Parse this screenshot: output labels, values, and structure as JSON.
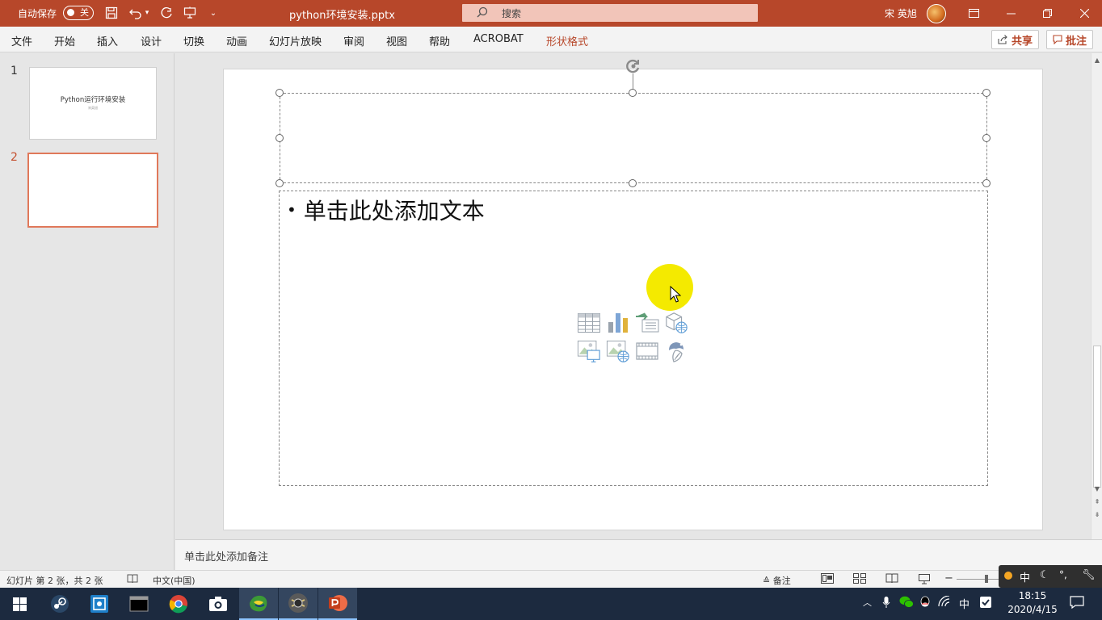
{
  "titlebar": {
    "autosave_label": "自动保存",
    "autosave_state": "关",
    "document_title": "python环境安装.pptx",
    "search_placeholder": "搜索",
    "user_name": "宋 英旭",
    "accent_color": "#b7472a"
  },
  "ribbon": {
    "tabs": [
      {
        "label": "文件"
      },
      {
        "label": "开始"
      },
      {
        "label": "插入"
      },
      {
        "label": "设计"
      },
      {
        "label": "切换"
      },
      {
        "label": "动画"
      },
      {
        "label": "幻灯片放映"
      },
      {
        "label": "审阅"
      },
      {
        "label": "视图"
      },
      {
        "label": "帮助"
      },
      {
        "label": "ACROBAT"
      },
      {
        "label": "形状格式"
      }
    ],
    "share_label": "共享",
    "comment_label": "批注"
  },
  "thumbnails": [
    {
      "number": "1",
      "title": "Python运行环境安装",
      "subtitle": "宋英旭"
    },
    {
      "number": "2",
      "title": "",
      "subtitle": ""
    }
  ],
  "slide": {
    "body_placeholder": "单击此处添加文本"
  },
  "notes": {
    "placeholder": "单击此处添加备注"
  },
  "statusbar": {
    "slide_info": "幻灯片 第 2 张，共 2 张",
    "language": "中文(中国)",
    "notes_label": "备注"
  },
  "ime": {
    "mode": "中"
  },
  "taskbar": {
    "tray_lang": "中",
    "time": "18:15",
    "date": "2020/4/15"
  },
  "icons": {
    "save": "save-icon",
    "undo": "undo-icon",
    "redo": "redo-icon",
    "search": "search-icon",
    "share": "share-icon",
    "comment": "comment-icon"
  }
}
